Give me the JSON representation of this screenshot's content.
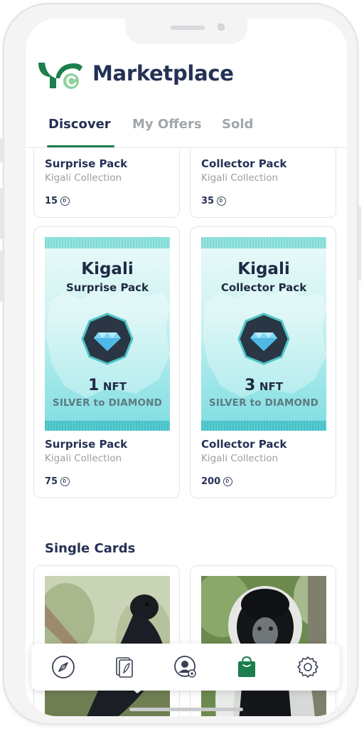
{
  "app": {
    "title": "Marketplace"
  },
  "tabs": [
    {
      "label": "Discover",
      "active": true
    },
    {
      "label": "My Offers",
      "active": false
    },
    {
      "label": "Sold",
      "active": false
    }
  ],
  "top_cards": [
    {
      "name": "Surprise Pack",
      "collection": "Kigali Collection",
      "price": "15"
    },
    {
      "name": "Collector Pack",
      "collection": "Kigali Collection",
      "price": "35"
    }
  ],
  "pack_cards": [
    {
      "name": "Surprise Pack",
      "collection": "Kigali Collection",
      "price": "75",
      "art": {
        "city": "Kigali",
        "kind": "Surprise Pack",
        "count": "1",
        "unit": "NFT",
        "range": "SILVER to DIAMOND"
      }
    },
    {
      "name": "Collector Pack",
      "collection": "Kigali Collection",
      "price": "200",
      "art": {
        "city": "Kigali",
        "kind": "Collector Pack",
        "count": "3",
        "unit": "NFT",
        "range": "SILVER to DIAMOND"
      }
    }
  ],
  "single_cards": {
    "title": "Single Cards"
  },
  "bottom_nav": [
    {
      "icon": "compass-icon",
      "active": false
    },
    {
      "icon": "cards-icon",
      "active": false
    },
    {
      "icon": "profile-icon",
      "active": false
    },
    {
      "icon": "shopping-bag-icon",
      "active": true
    },
    {
      "icon": "gear-icon",
      "active": false
    }
  ],
  "colors": {
    "primary": "#253155",
    "accent": "#1b7e4c",
    "muted": "#9a9da3"
  }
}
